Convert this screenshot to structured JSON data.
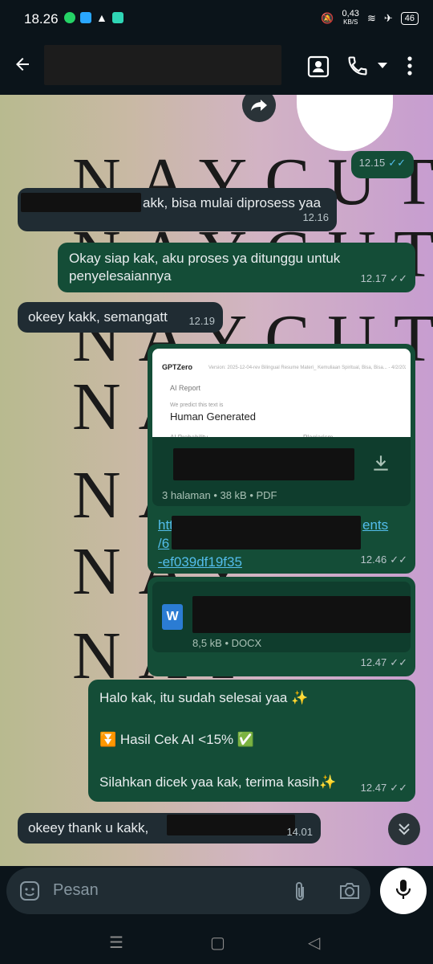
{
  "status_bar": {
    "time": "18.26",
    "net_speed_top": "0,43",
    "net_speed_unit": "KB/S",
    "battery": "46"
  },
  "header": {
    "title": ""
  },
  "wallpaper": {
    "watermark": "NAYCUTE",
    "watermark_short": "NAY"
  },
  "messages": [
    {
      "id": "m1",
      "time": "12.15"
    },
    {
      "id": "m2",
      "text": "akk, bisa mulai diprosess yaa",
      "time": "12.16"
    },
    {
      "id": "m3",
      "text": "Okay siap kak, aku proses ya ditunggu untuk penyelesaiannya",
      "time": "12.17"
    },
    {
      "id": "m4",
      "text": "okeey kakk, semangatt",
      "time": "12.19"
    },
    {
      "id": "m5",
      "preview_brand": "GPTZero",
      "preview_version": "Version: 2025-12-04-rev  Bilingual Resume Materi_ Kemuliaan Spiritual, Bisa, Bisa... - 4/2/2026",
      "preview_report": "AI Report",
      "preview_predict": "We predict this text is",
      "preview_result": "Human Generated",
      "preview_col1": "AI Probability",
      "preview_col2": "Plagiarism",
      "doc_meta": "3 halaman • 38 kB • PDF",
      "link_line1": "htt",
      "link_line1_end": "ents",
      "link_line2": "/6",
      "link_line3": "-ef039df19f35",
      "time": "12.46"
    },
    {
      "id": "m6",
      "file_icon_letter": "W",
      "doc_meta": "8,5 kB • DOCX",
      "time": "12.47"
    },
    {
      "id": "m7",
      "line1": "Halo kak, itu sudah selesai yaa ✨",
      "line2": "⏬ Hasil Cek AI <15% ✅",
      "line3": "Silahkan dicek yaa kak, terima kasih✨",
      "time": "12.47"
    },
    {
      "id": "m8",
      "text": "okeey thank u kakk,",
      "time": "14.01"
    }
  ],
  "composer": {
    "placeholder": "Pesan"
  },
  "colors": {
    "incoming": "#202c33",
    "outgoing": "#144d37",
    "link": "#53bdeb"
  },
  "icons": [
    "back-arrow-icon",
    "contact-card-icon",
    "phone-icon",
    "dropdown-icon",
    "more-vert-icon",
    "forward-icon",
    "download-icon",
    "word-icon",
    "double-check-icon",
    "emoji-icon",
    "attach-icon",
    "camera-icon",
    "mic-icon",
    "scroll-down-icon"
  ]
}
